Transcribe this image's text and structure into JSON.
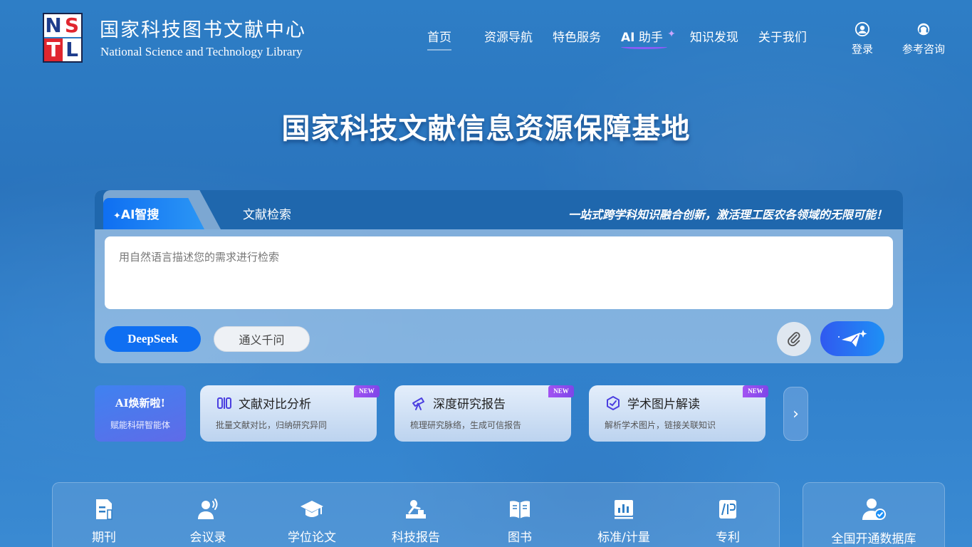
{
  "logo": {
    "letters": [
      "N",
      "S",
      "T",
      "L"
    ],
    "cn_name": "国家科技图书文献中心",
    "en_name": "National Science and Technology Library"
  },
  "nav": {
    "items": [
      {
        "label": "首页",
        "active": true
      },
      {
        "label": "资源导航"
      },
      {
        "label": "特色服务"
      },
      {
        "label_ai": "AI",
        "label": "助手"
      },
      {
        "label": "知识发现"
      },
      {
        "label": "关于我们"
      }
    ],
    "login": "登录",
    "consult": "参考咨询"
  },
  "hero": {
    "title": "国家科技文献信息资源保障基地"
  },
  "search": {
    "tabs": [
      {
        "label": "AI智搜",
        "active": true
      },
      {
        "label": "文献检索"
      }
    ],
    "slogan": "一站式跨学科知识融合创新，激活理工医农各领域的无限可能！",
    "placeholder": "用自然语言描述您的需求进行检索",
    "models": [
      "DeepSeek",
      "通义千问"
    ]
  },
  "promo": {
    "line1": "AI焕新啦!",
    "line2": "赋能科研智能体"
  },
  "features": [
    {
      "title": "文献对比分析",
      "desc": "批量文献对比，归纳研究异同",
      "badge": "NEW",
      "icon": "compare-icon"
    },
    {
      "title": "深度研究报告",
      "desc": "梳理研究脉络，生成可信报告",
      "badge": "NEW",
      "icon": "telescope-icon"
    },
    {
      "title": "学术图片解读",
      "desc": "解析学术图片，链接关联知识",
      "badge": "NEW",
      "icon": "image-analysis-icon"
    }
  ],
  "next_arrow": "›",
  "resources": [
    {
      "label": "期刊",
      "icon": "journal-icon"
    },
    {
      "label": "会议录",
      "icon": "conference-icon"
    },
    {
      "label": "学位论文",
      "icon": "graduation-cap-icon"
    },
    {
      "label": "科技报告",
      "icon": "report-icon"
    },
    {
      "label": "图书",
      "icon": "book-icon"
    },
    {
      "label": "标准/计量",
      "icon": "standard-chart-icon"
    },
    {
      "label": "专利",
      "icon": "patent-icon"
    }
  ],
  "database": {
    "label": "全国开通数据库",
    "icon": "user-check-icon"
  },
  "colors": {
    "primary": "#0f6ff2",
    "tabbar": "#1f67ad",
    "badge": "#8b4cf0",
    "logo_red": "#e0262f",
    "logo_navy": "#1d3c8c"
  }
}
